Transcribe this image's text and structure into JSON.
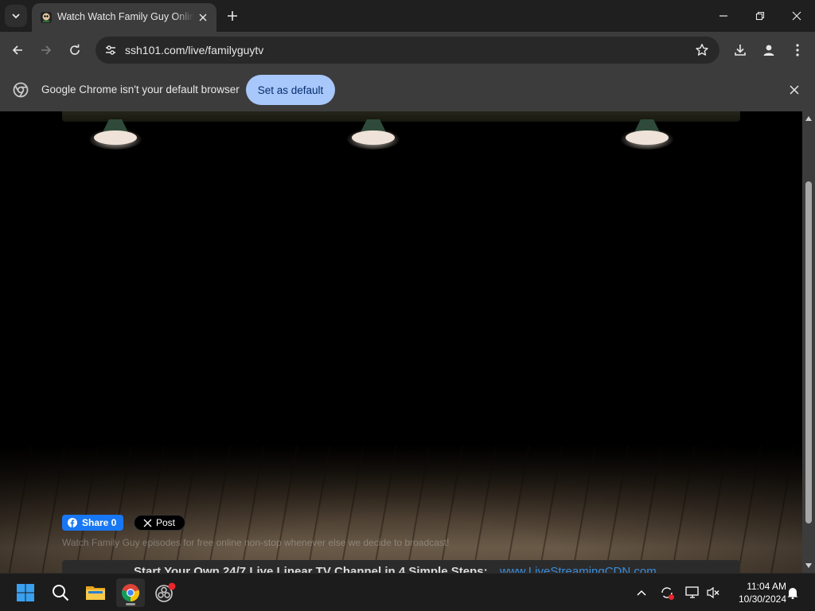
{
  "browser": {
    "tab": {
      "title": "Watch Watch Family Guy Online",
      "favicon": "family-guy-favicon"
    },
    "new_tab_icon": "plus-icon",
    "url": "ssh101.com/live/familyguytv"
  },
  "infobar": {
    "message": "Google Chrome isn't your default browser",
    "button_label": "Set as default"
  },
  "page": {
    "share": {
      "facebook_label": "Share 0",
      "x_label": "Post"
    },
    "description": "Watch Family Guy episodes for free online non-stop whenever else we decide to broadcast!",
    "banner": {
      "text": "Start Your Own 24/7 Live Linear TV Channel in 4 Simple Steps:",
      "link": "www.LiveStreamingCDN.com"
    }
  },
  "taskbar": {
    "time": "11:04 AM",
    "date": "10/30/2024"
  },
  "colors": {
    "accent": "#a8c7fa",
    "facebook": "#1877f2",
    "link": "#3a8ddd"
  }
}
